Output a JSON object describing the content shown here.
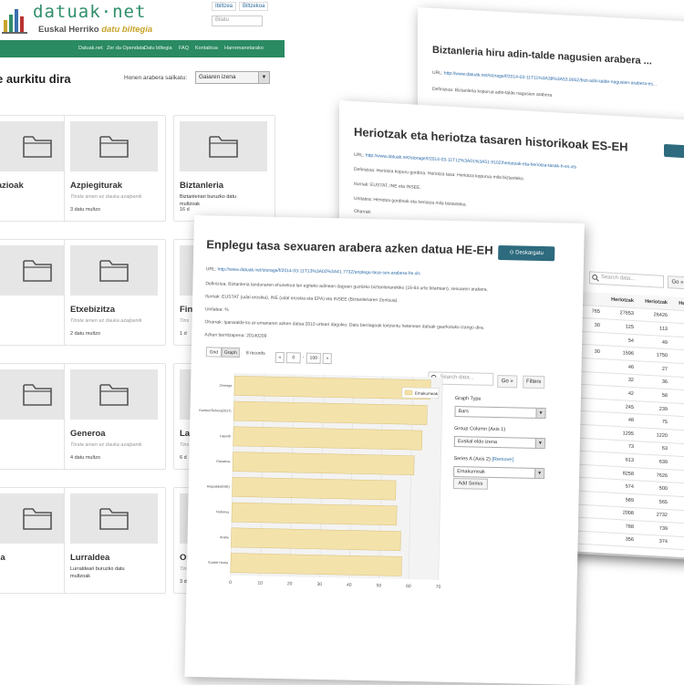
{
  "portal": {
    "logo_text": "datuak·net",
    "logo_tagline_main": "Euskal Herriko",
    "logo_tagline_accent": "datu biltegia",
    "lang_links": [
      "Ibiltzea",
      "Biltzekoa"
    ],
    "search_placeholder": "Bilatu",
    "nav": [
      "Datuak.net",
      "Zer da Opendata",
      "Datu biltegia",
      "FAQ",
      "Kontaktua",
      "Harremanetarako"
    ],
    "results_title": "e aurkitu dira",
    "sort_label": "Honen arabera sailkatu:",
    "sort_value": "Gaiaren izena",
    "cards": [
      {
        "title": "razioak",
        "desc": "",
        "count": "o"
      },
      {
        "title": "Azpiegiturak",
        "desc": "Tinste ienen ez dauka azalpenik",
        "count": "3 datu multzo"
      },
      {
        "title": "Biztanleria",
        "desc": "Biztanleriari buruzko datu",
        "desc2": "multzoak",
        "count": "16 d"
      },
      {
        "title": "",
        "desc": "",
        "count": "o"
      },
      {
        "title": "Etxebizitza",
        "desc": "Tinste ienen ez dauka azalpenik",
        "count": "2 datu multzo"
      },
      {
        "title": "Fin",
        "desc": "Tins",
        "count": "1 d"
      },
      {
        "title": "k",
        "desc": "",
        "count": "o"
      },
      {
        "title": "Generoa",
        "desc": "Tinste ienen ez dauka azalpenik",
        "count": "4 datu multzo"
      },
      {
        "title": "Lan",
        "desc": "Tins",
        "count": "6 d"
      },
      {
        "title": "zia",
        "desc": "",
        "count": "o"
      },
      {
        "title": "Lurraldea",
        "desc": "Lurraldeari buruzko datu",
        "desc2": "multzoak",
        "count": ""
      },
      {
        "title": "Ong",
        "desc": "Tins",
        "count": "3 d"
      }
    ]
  },
  "win_back": {
    "title": "Biztanleria hiru adin-talde nagusien arabera ...",
    "url_label": "URL:",
    "url": "http://www.datuak.net/storage/f/2014-03-11T11%3A38%3A53.900Z/bizt-adin-talde-nagusien-arabera-es...",
    "definition": "Definizioa: Biztanleria kopurua adin-talde nagusien arabera"
  },
  "win_mid": {
    "title": "Heriotzak eta heriotza tasaren historikoak ES-EH",
    "url_label": "URL:",
    "url": "http://www.datuak.net/storage/f/2014-03-11T12%3A01%3A51.910Z/heriotzak-eta-heriotza-tasak-h-es.xls",
    "definition": "Definizioa: Heriotza kopuru gordina. Heriotza tasa: Heriotza kopurua mila biztanleko.",
    "iturriak": "Iturriak: EUSTAT, INE eta INSEE.",
    "unitateak": "Unitatea: Heriotza gordinak eta heriotza mila biztanleko.",
    "oharrak": "Oharrak:",
    "search_placeholder": "Search data...",
    "go_label": "Go »",
    "columns": [
      "",
      "Heriotzak",
      "Heriotzak",
      "Heriotzak"
    ],
    "rows": [
      [
        "765",
        "27653",
        "26426",
        "2"
      ],
      [
        "30",
        "125",
        "113",
        ""
      ],
      [
        "",
        "54",
        "49",
        ""
      ],
      [
        "30",
        "1596",
        "1750",
        "1"
      ],
      [
        "",
        "46",
        "27",
        ""
      ],
      [
        "",
        "32",
        "36",
        ""
      ],
      [
        "",
        "42",
        "58",
        ""
      ],
      [
        "",
        "245",
        "239",
        ""
      ],
      [
        "",
        "48",
        "75",
        ""
      ],
      [
        "",
        "1295",
        "1220",
        "1"
      ],
      [
        "",
        "73",
        "63",
        ""
      ],
      [
        "",
        "613",
        "639",
        ""
      ],
      [
        "",
        "8258",
        "7626",
        "8"
      ],
      [
        "",
        "574",
        "500",
        ""
      ],
      [
        "",
        "589",
        "565",
        ""
      ],
      [
        "",
        "2008",
        "2732",
        "2"
      ],
      [
        "",
        "788",
        "739",
        ""
      ],
      [
        "",
        "356",
        "374",
        ""
      ]
    ]
  },
  "win_front": {
    "title": "Enplegu tasa sexuaren arabera azken datua HE-EH",
    "download_label": "⊙ Deskargatu",
    "url_label": "URL:",
    "url": "http://www.datuak.net/storage/f/2014-03-11T13%3A02%3A41.773Z/enplegu-tasa-sex-arabera-he.xls",
    "definition": "Definizioa: Biztanleria landunaren ehunekoa lan egiteko adinean dagoen guztizko biztanleriarekiko (16-64 urte bitartean), sexuaren arabera.",
    "iturriak": "Iturriak: EUSTAT (udal eroskia), INE (udal eroskia eta EPA) eta INSEE (Biztanleriaren Zentsua).",
    "unitateak": "Unitatea: %",
    "oharrak": "Oharrak: Ipararalde ko ar-emanaren azken datua 2010 urteari dagokio. Datu berriagoak lortzentu hetenean datuak gaurkotuko izango dira.",
    "azken": "Azken berritzapena: 20140209",
    "tab_grid": "Grid",
    "tab_graph": "Graph",
    "records_label": "8 records",
    "pager_prev": "«",
    "pager_from": "0",
    "pager_to": "100",
    "pager_next": "»",
    "search_placeholder": "Search data...",
    "go_label": "Go »",
    "filters_label": "Filters",
    "graph_type_label": "Graph Type",
    "graph_type_value": "Bars",
    "group_label": "Group Column (Axis 1)",
    "group_value": "Euskal eldo izena",
    "series_label": "Series A (Axis 2)",
    "series_remove": "[Remove]",
    "series_value": "Emakumeak",
    "add_series": "Add Series"
  },
  "chart_data": {
    "type": "bar",
    "orientation": "horizontal",
    "categories": [
      "Zereaga",
      "Kantaui Behera(2017)",
      "Lapurdi",
      "Gipuzkoa",
      "Hegoalde(EAE)",
      "Nafarroa",
      "Araba",
      "Euskal Herria"
    ],
    "series": [
      {
        "name": "Emakumeak",
        "values": [
          66,
          65,
          63.5,
          61,
          55,
          55.5,
          57,
          57.5
        ]
      }
    ],
    "xlim": [
      0,
      70
    ],
    "xticks": [
      0,
      10,
      20,
      30,
      40,
      50,
      60,
      70
    ],
    "colors": {
      "bar": "#f3e2aa",
      "bar_border": "#d9c07a",
      "plot_bg": "#f3f3f3",
      "grid": "#e0e0e0"
    },
    "legend_position": "top-right"
  }
}
